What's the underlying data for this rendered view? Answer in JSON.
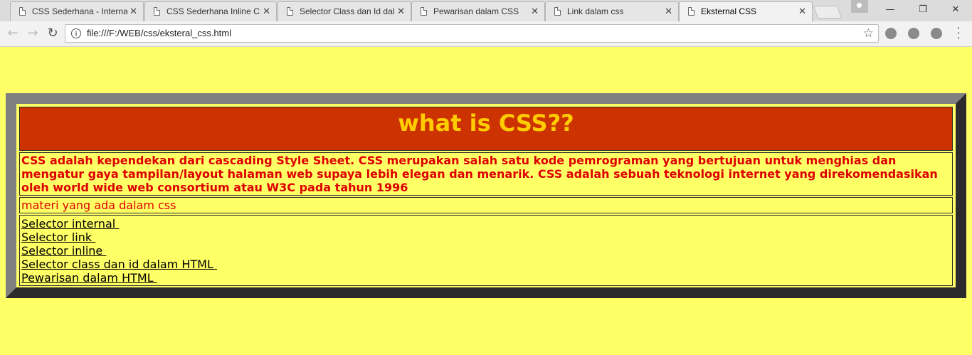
{
  "browser": {
    "tabs": [
      {
        "title": "CSS Sederhana - Internal"
      },
      {
        "title": "CSS Sederhana Inline CSS"
      },
      {
        "title": "Selector Class dan Id dalam"
      },
      {
        "title": "Pewarisan dalam CSS"
      },
      {
        "title": "Link dalam css"
      },
      {
        "title": "Eksternal CSS"
      }
    ],
    "url": "file:///F:/WEB/css/eksteral_css.html"
  },
  "page": {
    "heading": "what is CSS??",
    "description": "CSS adalah kependekan dari cascading Style Sheet. CSS merupakan salah satu kode pemrograman yang bertujuan untuk menghias dan mengatur gaya tampilan/layout halaman web supaya lebih elegan dan menarik. CSS adalah sebuah teknologi internet yang direkomendasikan oleh world wide web consortium atau W3C pada tahun 1996",
    "materi_label": "materi yang ada dalam css",
    "links": [
      {
        "label": "Selector internal "
      },
      {
        "label": "Selector link "
      },
      {
        "label": "Selector inline "
      },
      {
        "label": "Selector class dan id dalam HTML "
      },
      {
        "label": "Pewarisan dalam HTML "
      }
    ]
  },
  "colors": {
    "page_bg": "#ffff66",
    "header_bg": "#cc3300",
    "heading_text": "#ffcc00",
    "body_text": "#dd0000"
  }
}
